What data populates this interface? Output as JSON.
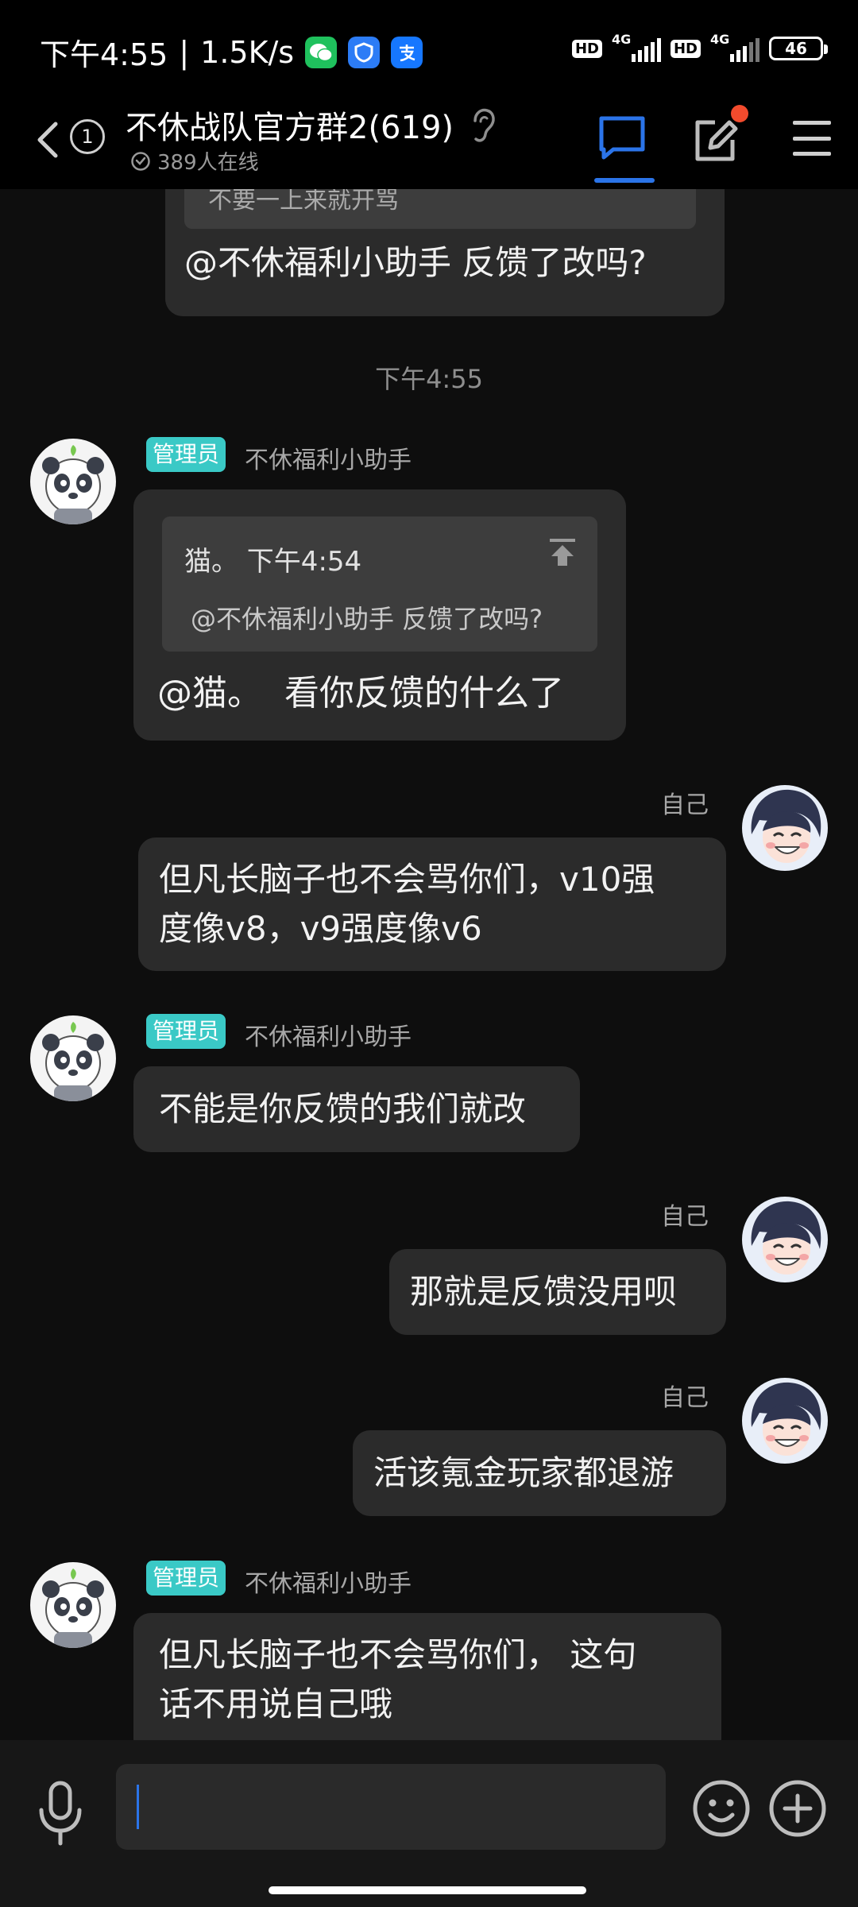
{
  "status_bar": {
    "time": "下午4:55",
    "speed": "1.5K/s",
    "hd1": "HD",
    "net1": "4G",
    "hd2": "HD",
    "net2": "4G",
    "battery": "46"
  },
  "header": {
    "unread_count": "1",
    "title": "不休战队官方群2(619)",
    "online_text": "389人在线"
  },
  "messages": {
    "top_partial": {
      "quote_fragment": "不要一上来就开骂",
      "text": "@不休福利小助手 反馈了改吗?"
    },
    "time_divider": "下午4:55",
    "m1": {
      "role": "管理员",
      "sender": "不休福利小助手",
      "quote_author": "猫。 下午4:54",
      "quote_text": "@不休福利小助手 反馈了改吗?",
      "text": "@猫。  看你反馈的什么了"
    },
    "m2": {
      "sender": "自己",
      "line1": "但凡长脑子也不会骂你们，v10强",
      "line2": "度像v8，v9强度像v6"
    },
    "m3": {
      "role": "管理员",
      "sender": "不休福利小助手",
      "text": "不能是你反馈的我们就改"
    },
    "m4": {
      "sender": "自己",
      "text": "那就是反馈没用呗"
    },
    "m5": {
      "sender": "自己",
      "text": "活该氪金玩家都退游"
    },
    "m6": {
      "role": "管理员",
      "sender": "不休福利小助手",
      "line1": "但凡长脑子也不会骂你们， 这句",
      "line2": "话不用说自己哦"
    }
  },
  "input": {
    "placeholder": ""
  },
  "colors": {
    "accent": "#2b74e8",
    "admin_badge": "#3ac9c6",
    "bubble": "#2b2b2b",
    "background": "#0e0e0e",
    "notification_dot": "#f24b2d"
  },
  "icons": {
    "back": "chevron-left-icon",
    "ear": "ear-icon",
    "chat": "chat-bubble-icon",
    "edit": "edit-icon",
    "menu": "hamburger-menu-icon",
    "mic": "microphone-icon",
    "emoji": "emoji-smile-icon",
    "plus": "plus-circle-icon",
    "pin": "pin-to-top-icon"
  }
}
